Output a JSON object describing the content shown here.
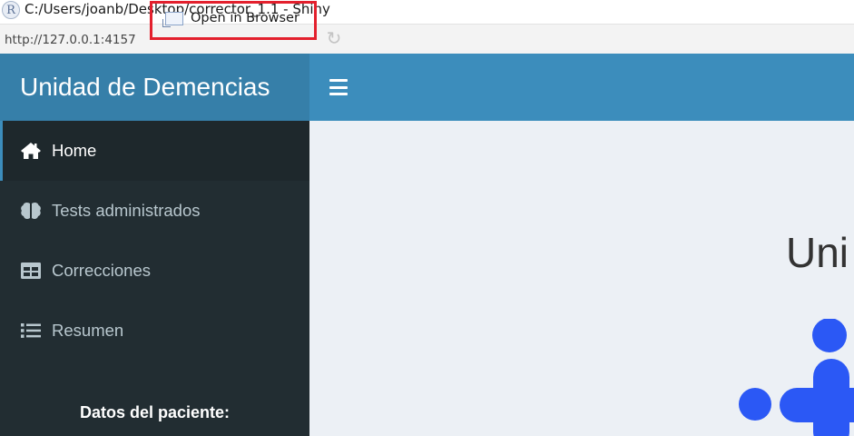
{
  "window": {
    "title": "C:/Users/joanb/Desktop/corrector_1.1 - Shiny",
    "app_icon_letter": "R"
  },
  "toolbar": {
    "url": "http://127.0.0.1:4157",
    "open_in_browser_label": "Open in Browser",
    "refresh_icon": "refresh-icon",
    "highlight_color": "#e3202d"
  },
  "header": {
    "logo_text": "Unidad de Demencias",
    "logo_bg": "#367fa9",
    "navbar_bg": "#3c8dbc"
  },
  "sidebar": {
    "items": [
      {
        "label": "Home",
        "icon": "home-icon",
        "active": true
      },
      {
        "label": "Tests administrados",
        "icon": "brain-icon",
        "active": false
      },
      {
        "label": "Correcciones",
        "icon": "table-icon",
        "active": false
      },
      {
        "label": "Resumen",
        "icon": "list-icon",
        "active": false
      }
    ],
    "patient_section_title": "Datos del paciente:"
  },
  "content": {
    "heading": "Uni",
    "logo_color": "#2b58f5"
  }
}
